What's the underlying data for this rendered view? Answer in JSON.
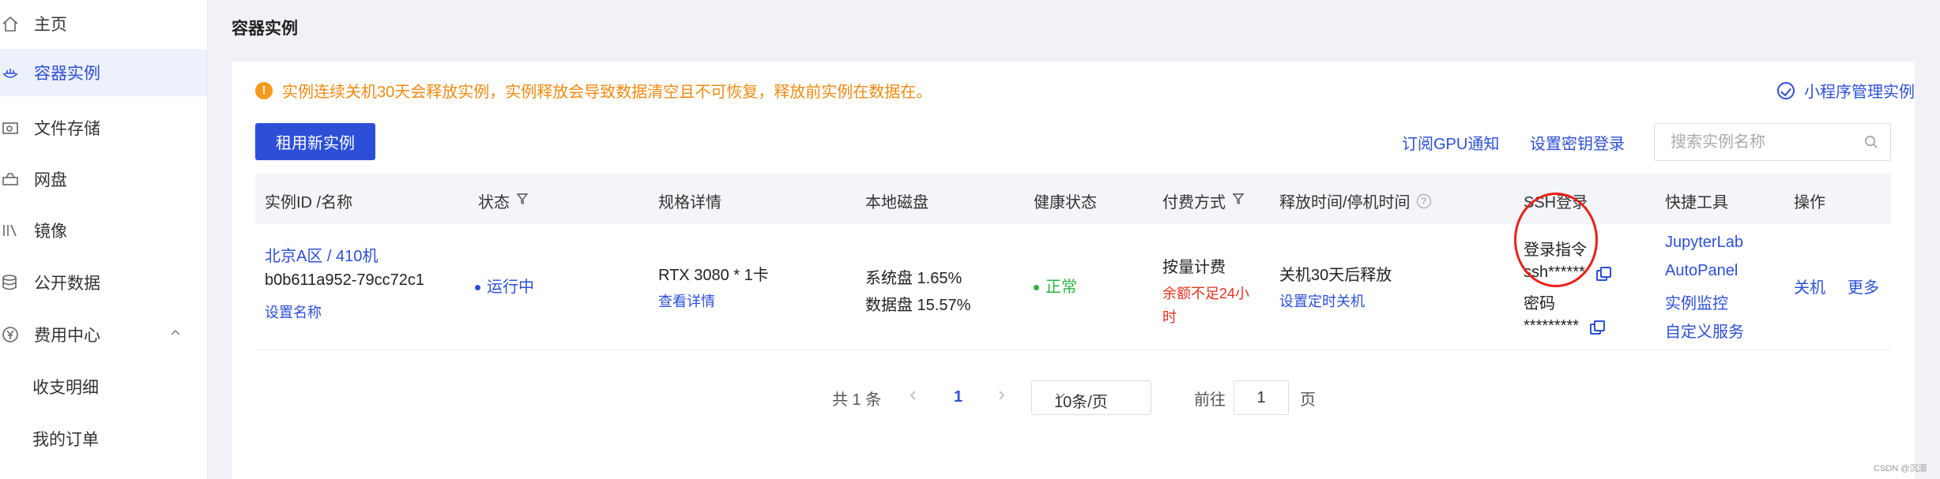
{
  "sidebar": {
    "items": [
      {
        "label": "主页",
        "icon": "home-icon"
      },
      {
        "label": "容器实例",
        "icon": "container-icon",
        "active": true
      },
      {
        "label": "文件存储",
        "icon": "file-storage-icon"
      },
      {
        "label": "网盘",
        "icon": "netdisk-icon"
      },
      {
        "label": "镜像",
        "icon": "image-icon"
      },
      {
        "label": "公开数据",
        "icon": "database-icon"
      },
      {
        "label": "费用中心",
        "icon": "yen-icon",
        "expanded": true
      },
      {
        "label": "收支明细"
      },
      {
        "label": "我的订单"
      }
    ]
  },
  "page": {
    "title": "容器实例"
  },
  "notice": {
    "text": "实例连续关机30天会释放实例，实例释放会导致数据清空且不可恢复，释放前实例在数据在。"
  },
  "mini_program_link": "小程序管理实例",
  "toolbar": {
    "rent_button": "租用新实例",
    "subscribe_gpu": "订阅GPU通知",
    "set_key_login": "设置密钥登录",
    "search_placeholder": "搜索实例名称"
  },
  "table": {
    "headers": {
      "id_name": "实例ID /名称",
      "status": "状态",
      "spec": "规格详情",
      "disk": "本地磁盘",
      "health": "健康状态",
      "billing": "付费方式",
      "release": "释放时间/停机时间",
      "ssh": "SSH登录",
      "tools": "快捷工具",
      "actions": "操作"
    },
    "row": {
      "region": "北京A区 / 410机",
      "instance_id": "b0b611a952-79cc72c1",
      "set_name": "设置名称",
      "status": "运行中",
      "spec": "RTX 3080 * 1卡",
      "spec_detail": "查看详情",
      "disk_system": "系统盘 1.65%",
      "disk_data": "数据盘 15.57%",
      "health": "正常",
      "billing": "按量计费",
      "billing_warn_1": "余额不足24小",
      "billing_warn_2": "时",
      "release": "关机30天后释放",
      "set_timer": "设置定时关机",
      "ssh_cmd_label": "登录指令",
      "ssh_cmd_value": "ssh******",
      "ssh_pwd_label": "密码",
      "ssh_pwd_value": "*********",
      "tools": [
        "JupyterLab",
        "AutoPanel",
        "实例监控",
        "自定义服务"
      ],
      "action_shutdown": "关机",
      "action_more": "更多"
    }
  },
  "pagination": {
    "total": "共 1 条",
    "current": "1",
    "page_size": "10条/页",
    "goto_label": "前往",
    "goto_value": "1",
    "page_suffix": "页"
  },
  "watermark": "CSDN @沉溺",
  "colors": {
    "accent": "#2d4fd8",
    "warning": "#f08a12",
    "danger": "#e8321c",
    "success": "#2fb344"
  }
}
